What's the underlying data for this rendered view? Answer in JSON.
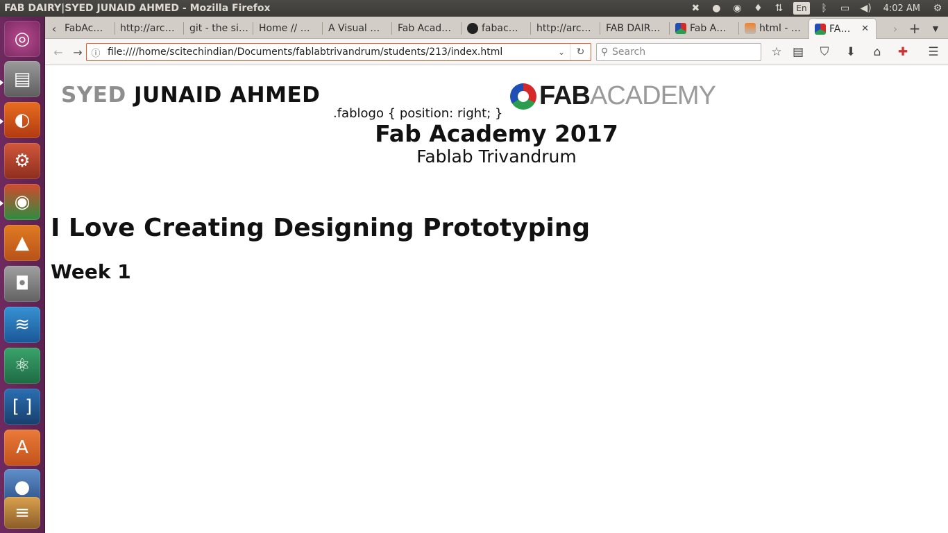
{
  "window": {
    "title": "FAB DAIRY|SYED JUNAID AHMED - Mozilla Firefox"
  },
  "tray": {
    "icons": [
      "dropbox-icon",
      "drop-icon",
      "chrome-icon",
      "mic-icon",
      "network-icon",
      "keyboard-icon",
      "bluetooth-icon",
      "battery-icon",
      "volume-icon",
      "settings-icon"
    ],
    "keyboard_layout": "En",
    "clock": "4:02 AM"
  },
  "launcher": {
    "apps": [
      "ubuntu-dash",
      "files",
      "firefox",
      "system-settings",
      "chrome",
      "vlc",
      "camera",
      "remmina",
      "atom",
      "brackets",
      "software-center",
      "app",
      "stacked"
    ]
  },
  "tabs": [
    {
      "label": "FabAc…"
    },
    {
      "label": "http://arc…"
    },
    {
      "label": "git - the si…"
    },
    {
      "label": "Home // …"
    },
    {
      "label": "A Visual …"
    },
    {
      "label": "Fab Acad…"
    },
    {
      "label": "fabac…"
    },
    {
      "label": "http://arc…"
    },
    {
      "label": "FAB DAIR…"
    },
    {
      "label": "Fab A…"
    },
    {
      "label": "html - …"
    },
    {
      "label": "FA…"
    }
  ],
  "navbar": {
    "url": "file:////home/scitechindian/Documents/fablabtrivandrum/students/213/index.html",
    "search_placeholder": "Search"
  },
  "page": {
    "name_first": "SYED",
    "name_last": "JUNAID AHMED",
    "logo_fab": "FAB",
    "logo_academy": "ACADEMY",
    "css_text": ".fablogo { position: right; }",
    "academy_heading": "Fab Academy 2017",
    "lab_heading": "Fablab Trivandrum",
    "tagline": "I Love Creating Designing Prototyping",
    "week": "Week 1"
  },
  "colors": {
    "accent_url_border": "#e05a2b",
    "launcher_bg": "#5b2250",
    "name_first": "#8e8e8e"
  }
}
